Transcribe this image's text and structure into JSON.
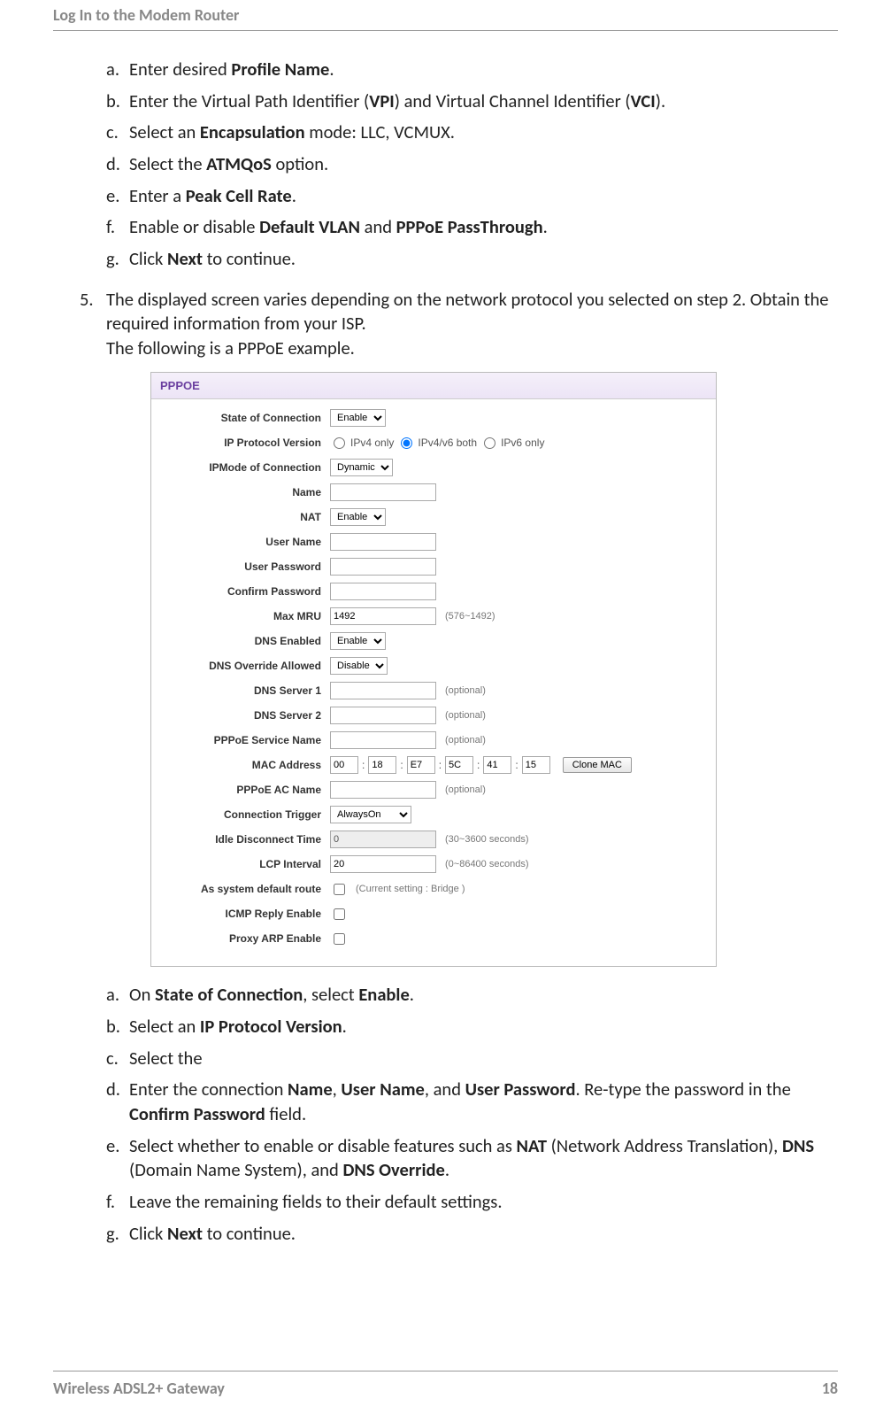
{
  "header": "Log In to the Modem Router",
  "list1": {
    "a": {
      "pre": "Enter desired ",
      "b1": "Profile Name",
      "post": "."
    },
    "b": {
      "pre": "Enter the Virtual Path Identifier (",
      "b1": "VPI",
      "mid": ") and Virtual Channel Identifier (",
      "b2": "VCI",
      "post": ")."
    },
    "c": {
      "pre": "Select an ",
      "b1": "Encapsulation",
      "post": " mode: LLC, VCMUX."
    },
    "d": {
      "pre": "Select the ",
      "b1": "ATMQoS",
      "post": " option."
    },
    "e": {
      "pre": "Enter a ",
      "b1": "Peak Cell Rate",
      "post": "."
    },
    "f": {
      "pre": "Enable or disable ",
      "b1": "Default VLAN",
      "mid": " and ",
      "b2": "PPPoE PassThrough",
      "post": "."
    },
    "g": {
      "pre": "Click ",
      "b1": "Next",
      "post": " to continue."
    }
  },
  "step5": {
    "marker": "5.",
    "line1": "The displayed screen varies depending on the network protocol you selected on step 2. Obtain the required information from your ISP.",
    "line2": "The following is a PPPoE example."
  },
  "form": {
    "title": "PPPOE",
    "labels": {
      "state": "State of Connection",
      "ipver": "IP Protocol Version",
      "ipmode": "IPMode of Connection",
      "name": "Name",
      "nat": "NAT",
      "uname": "User Name",
      "upass": "User Password",
      "cpass": "Confirm Password",
      "mru": "Max MRU",
      "dnse": "DNS Enabled",
      "dnso": "DNS Override Allowed",
      "dns1": "DNS Server 1",
      "dns2": "DNS Server 2",
      "psn": "PPPoE Service Name",
      "mac": "MAC Address",
      "acn": "PPPoE AC Name",
      "trig": "Connection Trigger",
      "idle": "Idle Disconnect Time",
      "lcp": "LCP Interval",
      "defr": "As system default route",
      "icmp": "ICMP Reply Enable",
      "parp": "Proxy ARP Enable"
    },
    "options": {
      "enable": "Enable",
      "disable": "Disable",
      "dynamic": "Dynamic",
      "alwayson": "AlwaysOn",
      "ipv4only": "IPv4 only",
      "ipv46": "IPv4/v6 both",
      "ipv6only": "IPv6 only"
    },
    "values": {
      "mru": "1492",
      "mru_hint": "(576~1492)",
      "optional": "(optional)",
      "mac": [
        "00",
        "18",
        "E7",
        "5C",
        "41",
        "15"
      ],
      "clone": "Clone MAC",
      "idle": "0",
      "idle_hint": "(30~3600 seconds)",
      "lcp": "20",
      "lcp_hint": "(0~86400 seconds)",
      "defr_hint": "(Current setting : Bridge )"
    }
  },
  "list2": {
    "a": {
      "pre": "On ",
      "b1": "State of Connection",
      "mid": ", select ",
      "b2": "Enable",
      "post": "."
    },
    "b": {
      "pre": "Select an ",
      "b1": "IP Protocol Version",
      "post": "."
    },
    "c": {
      "pre": "Select the"
    },
    "d": {
      "pre": "Enter the connection ",
      "b1": "Name",
      "mid1": ", ",
      "b2": "User Name",
      "mid2": ", and ",
      "b3": "User Password",
      "mid3": ". Re-type the password in the ",
      "b4": "Confirm Password",
      "post": " field."
    },
    "e": {
      "pre": "Select whether to enable or disable features such as ",
      "b1": "NAT",
      "mid1": " (Network Address Translation), ",
      "b2": "DNS",
      "mid2": " (Domain Name System), and ",
      "b3": "DNS Override",
      "post": "."
    },
    "f": {
      "pre": "Leave the remaining fields to their default settings."
    },
    "g": {
      "pre": "Click ",
      "b1": "Next",
      "post": " to continue."
    }
  },
  "footer": {
    "left": "Wireless ADSL2+ Gateway",
    "right": "18"
  }
}
